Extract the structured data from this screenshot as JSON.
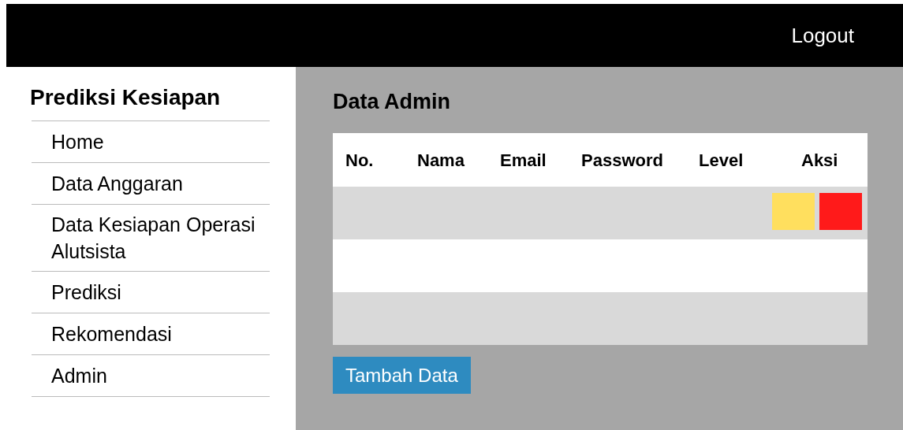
{
  "header": {
    "logout": "Logout"
  },
  "sidebar": {
    "title": "Prediksi Kesiapan",
    "items": [
      {
        "label": "Home"
      },
      {
        "label": "Data Anggaran"
      },
      {
        "label": "Data Kesiapan Operasi Alutsista"
      },
      {
        "label": "Prediksi"
      },
      {
        "label": "Rekomendasi"
      },
      {
        "label": "Admin"
      }
    ]
  },
  "main": {
    "title": "Data Admin",
    "table": {
      "columns": [
        "No.",
        "Nama",
        "Email",
        "Password",
        "Level",
        "Aksi"
      ],
      "rows": [
        {
          "actions": [
            {
              "color": "#ffdf5e"
            },
            {
              "color": "#ff1a1a"
            }
          ]
        },
        {},
        {}
      ]
    },
    "add_button": "Tambah Data"
  }
}
